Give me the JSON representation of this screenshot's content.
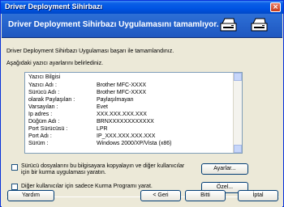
{
  "window": {
    "title": "Driver Deployment Sihirbazı",
    "close_glyph": "×"
  },
  "header": {
    "title": "Driver Deployment Sihirbazı Uygulamasını tamamlıyor.",
    "icons": [
      "printer-icon",
      "printer-icon"
    ]
  },
  "messages": {
    "completed": "Driver Deployment Sihirbazı Uygulaması başarı ile tamamlandınız.",
    "settings_defined": "Aşağıdaki yazıcı ayarlarını belirlediniz."
  },
  "printer_info": {
    "heading": "Yazıcı Bilgisi",
    "rows": [
      {
        "label": "Yazıcı Adı :",
        "value": "Brother   MFC-XXXX"
      },
      {
        "label": "Sürücü Adı :",
        "value": "Brother   MFC-XXXX"
      },
      {
        "label": "olarak Paylaşılan :",
        "value": "Paylaşılmayan"
      },
      {
        "label": "Varsayılan :",
        "value": "Evet"
      },
      {
        "label": "Ip adres :",
        "value": "XXX.XXX.XXX.XXX"
      },
      {
        "label": "Düğüm Adı :",
        "value": "BRNXXXXXXXXXXXX"
      },
      {
        "label": "Port Sürücüsü :",
        "value": "LPR"
      },
      {
        "label": "Port Adı :",
        "value": "IP_XXX.XXX.XXX.XXX"
      },
      {
        "label": "Sürüm :",
        "value": "Windows 2000/XP/Vista (x86)"
      }
    ]
  },
  "options": {
    "copy_driver_files": "Sürücü dosyalarını bu bilgisayara kopyalayın ve diğer kullanıcılar için bir kurma uygulaması yaratın.",
    "create_setup_program": "Diğer kullanıcılar için sadece Kurma Programı yarat."
  },
  "buttons": {
    "settings": "Ayarlar...",
    "custom": "Özel...",
    "help": "Yardım",
    "back": "< Geri",
    "finish": "Bitti",
    "cancel": "İptal"
  }
}
